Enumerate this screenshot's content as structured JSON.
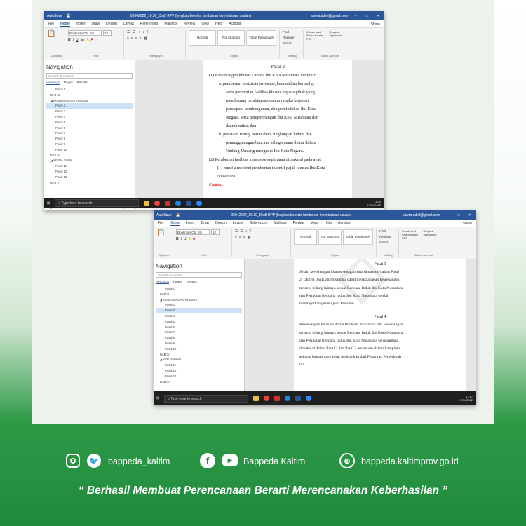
{
  "win1": {
    "title": "05042022_16.30_Draft RPP (lengkap beserta tambahan inventarisasi usulan)",
    "autosave": "AutoSave",
    "user": "kawra.adiel@gmail.com",
    "menus": [
      "File",
      "Home",
      "Insert",
      "Draw",
      "Design",
      "Layout",
      "References",
      "Mailings",
      "Review",
      "View",
      "Help",
      "Acrobat"
    ],
    "share": "Share",
    "font": "Bookman Old Sty",
    "font_size": "12",
    "styles": [
      "Normal",
      "No Spacing",
      "Table Paragraph"
    ],
    "editing": [
      "Find",
      "Replace",
      "Select"
    ],
    "adobe": [
      "Create and Share Adobe PDF",
      "Request Signatures"
    ],
    "groups": [
      "Clipboard",
      "Font",
      "Paragraph",
      "Styles",
      "Editing",
      "Adobe Acrobat"
    ],
    "nav_title": "Navigation",
    "nav_search": "Search document",
    "nav_tabs": [
      "Headings",
      "Pages",
      "Results"
    ],
    "nav_items": [
      {
        "t": "Pasal 1",
        "l": "l2",
        "s": false
      },
      {
        "t": "BAB III",
        "l": "l1",
        "s": false
      },
      {
        "t": "◢ KEWENANGAN KHUSUS",
        "l": "l1",
        "s": false
      },
      {
        "t": "Pasal 2",
        "l": "l2",
        "s": true
      },
      {
        "t": "Pasal 3",
        "l": "l2",
        "s": false
      },
      {
        "t": "Pasal 4",
        "l": "l2",
        "s": false
      },
      {
        "t": "Pasal 5",
        "l": "l2",
        "s": false
      },
      {
        "t": "Pasal 6",
        "l": "l2",
        "s": false
      },
      {
        "t": "Pasal 7",
        "l": "l2",
        "s": false
      },
      {
        "t": "Pasal 8",
        "l": "l2",
        "s": false
      },
      {
        "t": "Pasal 9",
        "l": "l2",
        "s": false
      },
      {
        "t": "Pasal 10",
        "l": "l2",
        "s": false
      },
      {
        "t": "BAB IV",
        "l": "l1",
        "s": false
      },
      {
        "t": "◢ KERJA SAMA",
        "l": "l1",
        "s": false
      },
      {
        "t": "Pasal 11",
        "l": "l2",
        "s": false
      },
      {
        "t": "Pasal 12",
        "l": "l2",
        "s": false
      },
      {
        "t": "Pasal 13",
        "l": "l2",
        "s": false
      },
      {
        "t": "BAB V",
        "l": "l1",
        "s": false
      }
    ],
    "heading": "Pasal 2",
    "lines": [
      "(1)   Kewenangan khusus Otorita Ibu Kota Nusantara meliputi:",
      "a.   pemberian perizinan investasi, kemudahan berusaha,",
      "serta pemberian fasilitas khusus kepada pihak yang",
      "mendukung pembiayaan dalam rangka kegiatan",
      "persiapan, pembangunan, dan pemindahan Ibu Kota",
      "Negara, serta pengembangan Ibu Kota Nusantara dan",
      "daerah mitra; dan",
      "b.   penataan ruang, pertanahan, lingkungan hidup, dan",
      "penanggulangan bencana sebagaimana diatur dalam",
      "Undang-Undang mengenai Ibu Kota Negara.",
      "(2)   Pemberian fasilitas khusus sebagaimana dimaksud pada ayat",
      "(1) huruf a meliputi pemberian insentif pajak khusus Ibu Kota",
      "Nusantara."
    ],
    "catatan": "Catatan:",
    "status": [
      "Page 1 of 11",
      "10101 words",
      "Indonesian",
      "Accessibility: Investigate",
      "Focus",
      "138%"
    ],
    "time": "11:09",
    "date": "07/04/2022",
    "lang": "ENG INTL"
  },
  "win2": {
    "title": "05042022_16.30_Draft RPP (lengkap beserta tambahan inventarisasi usulan)",
    "heading1": "Pasal 3",
    "lines1": [
      "Selain kewenangan khusus sebagaimana dimaksud dalam Pasal",
      "2, Otorita Ibu Kota Nusantara dapat melaksanakan kewenangan",
      "tertentu bidang lainnya sesuai Rencana Induk Ibu Kota Nusantara",
      "dan Perincian Rencana Induk Ibu Kota Nusantara setelah",
      "mendapatkan persetujuan Presiden."
    ],
    "heading2": "Pasal 4",
    "lines2": [
      "Kewenangan khusus Otorita Ibu Kota Nusantara dan kewenangan",
      "tertentu bidang lainnya sesuai Rencana Induk Ibu Kota Nusantara",
      "dan Perincian Rencana Induk Ibu Kota Nusantara sebagaimana",
      "dimaksud dalam Pasal 2 dan Pasal 3 tercantum dalam Lampiran",
      "sebagai bagian yang tidak terpisahkan dari Peraturan Pemerintah",
      "ini."
    ],
    "nav_items": [
      {
        "t": "Pasal 1",
        "l": "l2",
        "s": false
      },
      {
        "t": "BAB III",
        "l": "l1",
        "s": false
      },
      {
        "t": "◢ KEWENANGAN KHUSUS",
        "l": "l1",
        "s": false
      },
      {
        "t": "Pasal 2",
        "l": "l2",
        "s": false
      },
      {
        "t": "Pasal 3",
        "l": "l2",
        "s": true
      },
      {
        "t": "Pasal 4",
        "l": "l2",
        "s": false
      },
      {
        "t": "Pasal 5",
        "l": "l2",
        "s": false
      },
      {
        "t": "Pasal 6",
        "l": "l2",
        "s": false
      },
      {
        "t": "Pasal 7",
        "l": "l2",
        "s": false
      },
      {
        "t": "Pasal 8",
        "l": "l2",
        "s": false
      },
      {
        "t": "Pasal 9",
        "l": "l2",
        "s": false
      },
      {
        "t": "Pasal 10",
        "l": "l2",
        "s": false
      },
      {
        "t": "BAB IV",
        "l": "l1",
        "s": false
      },
      {
        "t": "◢ KERJA SAMA",
        "l": "l1",
        "s": false
      },
      {
        "t": "Pasal 11",
        "l": "l2",
        "s": false
      },
      {
        "t": "Pasal 12",
        "l": "l2",
        "s": false
      },
      {
        "t": "Pasal 13",
        "l": "l2",
        "s": false
      },
      {
        "t": "BAB IV",
        "l": "l1",
        "s": false
      }
    ],
    "status": [
      "Page 4 of 11",
      "10101 words",
      "Indonesian",
      "Accessibility: Investigate",
      "Focus",
      "100%"
    ],
    "time": "11:17",
    "date": "07/04/2022",
    "lang": "ENG INTL"
  },
  "taskbar_search": "Type here to search",
  "social": {
    "instagram_twitter": "bappeda_kaltim",
    "facebook_youtube": "Bappeda Kaltim",
    "website": "bappeda.kaltimprov.go.id"
  },
  "slogan": "“ Berhasil  Membuat Perencanaan Berarti Merencanakan Keberhasilan ”",
  "colors": {
    "word_blue": "#2b579a",
    "brand_green": "#1f8a3c"
  }
}
